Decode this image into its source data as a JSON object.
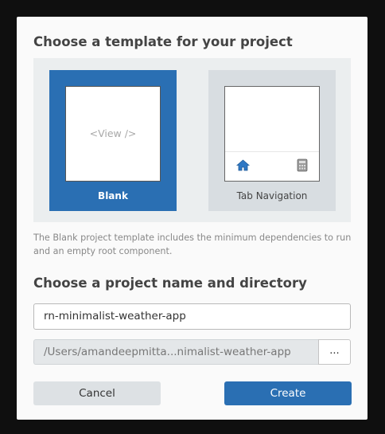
{
  "dialog": {
    "template_heading": "Choose a template for your project",
    "templates": [
      {
        "label": "Blank",
        "preview_text": "<View />",
        "selected": true
      },
      {
        "label": "Tab Navigation",
        "selected": false
      }
    ],
    "description": "The Blank project template includes the minimum dependencies to run and an empty root component.",
    "name_heading": "Choose a project name and directory",
    "project_name": "rn-minimalist-weather-app",
    "directory": "/Users/amandeepmitta...nimalist-weather-app",
    "browse_label": "...",
    "cancel_label": "Cancel",
    "create_label": "Create"
  },
  "icons": {
    "tab1": "home-icon",
    "tab2": "calculator-icon"
  },
  "colors": {
    "accent": "#2a6fb3",
    "tile_inactive": "#d8dde1",
    "template_panel": "#ebeeef"
  }
}
